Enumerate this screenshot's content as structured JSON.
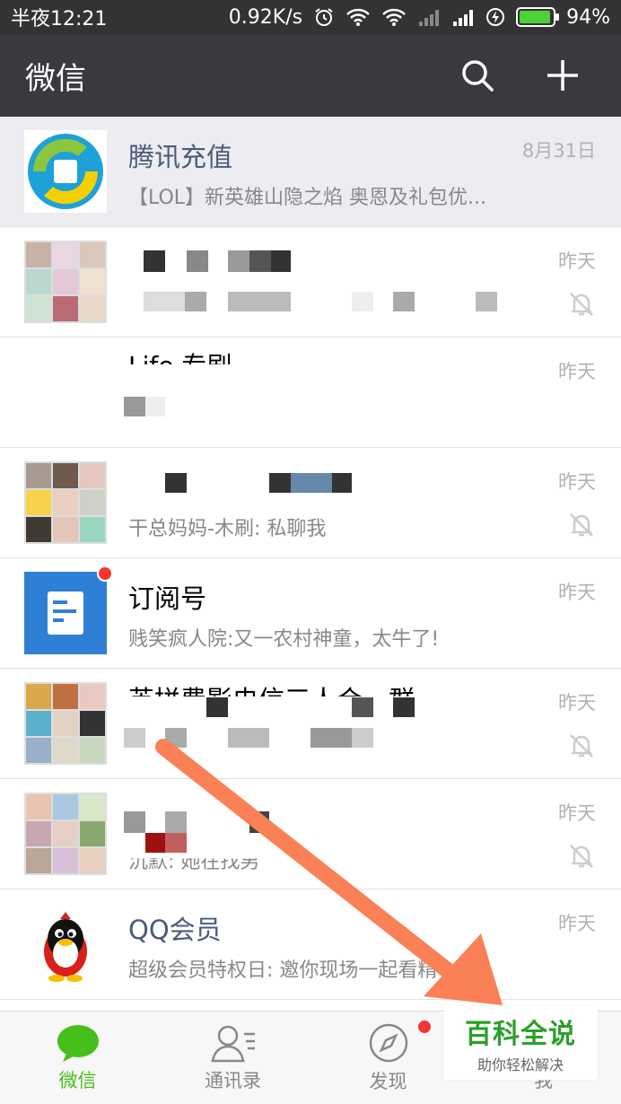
{
  "status": {
    "time": "半夜12:21",
    "network_speed": "0.92K/s",
    "battery": "94%",
    "battery_level": 0.94
  },
  "appbar": {
    "title": "微信"
  },
  "chats": [
    {
      "title": "腾讯充值",
      "preview": "【LOL】新英雄山隐之焰 奥恩及礼包优...",
      "time": "8月31日",
      "pinned": true,
      "muted": false
    },
    {
      "title": "",
      "preview": "",
      "time": "昨天",
      "muted": true
    },
    {
      "title": "Life 专刷",
      "preview": "",
      "time": "昨天",
      "muted": false
    },
    {
      "title": "",
      "preview": "干总妈妈-木刷: 私聊我",
      "time": "昨天",
      "muted": true
    },
    {
      "title": "订阅号",
      "preview": "贱笑疯人院:又一农村神童，太牛了!",
      "time": "昨天",
      "muted": false,
      "unread_dot": true
    },
    {
      "title": "英拼费影电信三人合一群",
      "preview": "",
      "time": "昨天",
      "muted": true
    },
    {
      "title": "",
      "preview": "沉默: 她在找男",
      "time": "昨天",
      "muted": true
    },
    {
      "title": "QQ会员",
      "preview": "超级会员特权日: 邀你现场一起看精",
      "time": "昨天",
      "muted": false
    }
  ],
  "tabs": [
    {
      "label": "微信",
      "active": true
    },
    {
      "label": "通讯录",
      "active": false
    },
    {
      "label": "发现",
      "active": false,
      "dot": true
    },
    {
      "label": "我",
      "active": false
    }
  ],
  "watermark": {
    "title": "百科全说",
    "subtitle": "助你轻松解决"
  },
  "colors": {
    "accent": "#45c01a",
    "appbar": "#393a3f",
    "arrow": "#fa8055",
    "badge": "#f43530"
  }
}
